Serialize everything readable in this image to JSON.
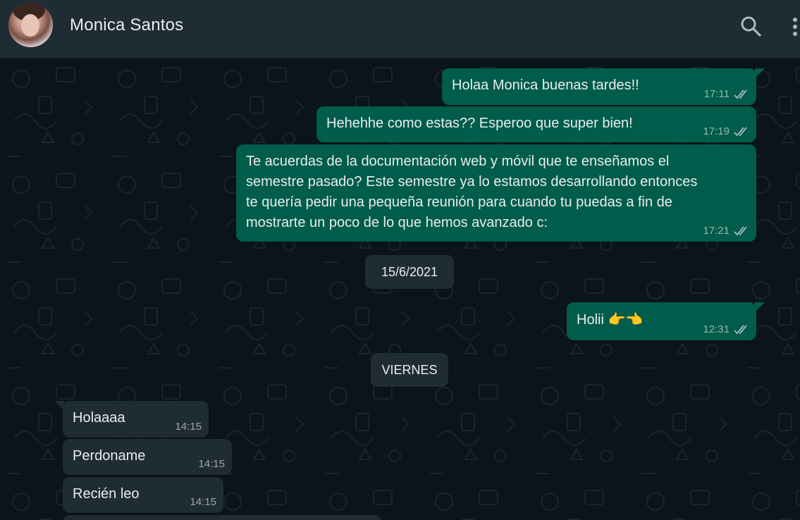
{
  "header": {
    "contact_name": "Monica Santos",
    "search_icon": "search-icon",
    "menu_icon": "more-vertical-icon"
  },
  "colors": {
    "header_bg": "#202c33",
    "chat_bg": "#0b141a",
    "outgoing_bubble": "#005c4b",
    "incoming_bubble": "#202c33",
    "date_chip": "#1f2c33",
    "text": "#e9edef"
  },
  "messages": [
    {
      "direction": "out",
      "text": "Holaa Monica buenas tardes!!",
      "time": "17:11",
      "status": "read"
    },
    {
      "direction": "out",
      "text": "Hehehhe como estas?? Esperoo que super bien!",
      "time": "17:19",
      "status": "read"
    },
    {
      "direction": "out",
      "lines": [
        "Te acuerdas de la documentación web y móvil que te enseñamos el",
        "semestre pasado? Este semestre ya lo estamos desarrollando entonces",
        "te quería pedir una pequeña reunión para cuando tu puedas a fin de",
        "mostrarte un poco de lo que hemos avanzado c:"
      ],
      "time": "17:21",
      "status": "read"
    },
    {
      "direction": "out",
      "text": "Holii",
      "emoji": "👉👈",
      "time": "12:31",
      "status": "read"
    },
    {
      "direction": "in",
      "text": "Holaaaa",
      "time": "14:15"
    },
    {
      "direction": "in",
      "text": "Perdoname",
      "time": "14:15"
    },
    {
      "direction": "in",
      "text": "Recién leo",
      "time": "14:15"
    }
  ],
  "date_separators": [
    "15/6/2021",
    "VIERNES"
  ]
}
